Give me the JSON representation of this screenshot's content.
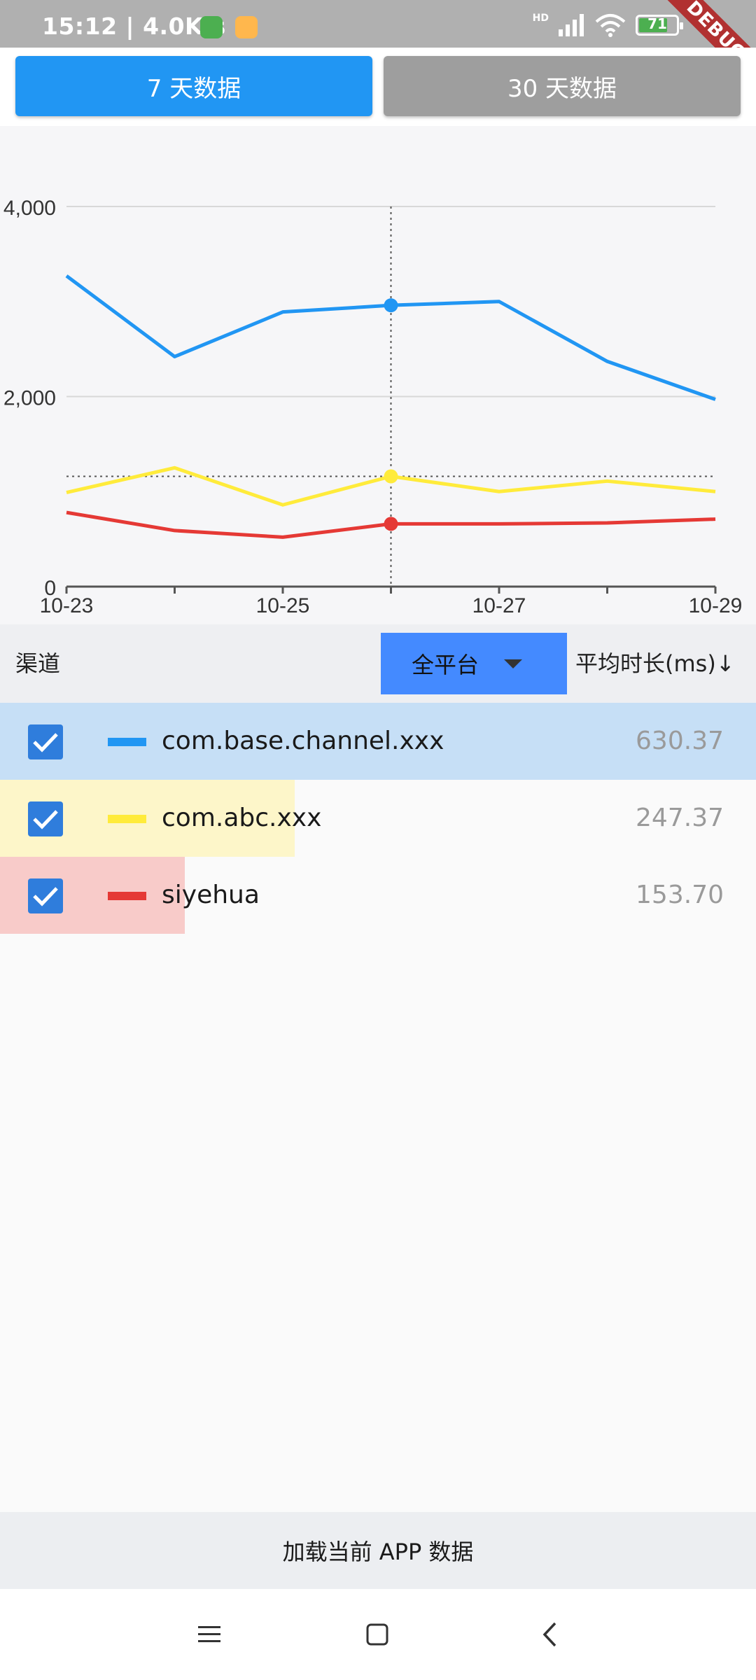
{
  "status_bar": {
    "time_speed": "15:12 | 4.0K/s",
    "battery_level": "71",
    "debug_label": "DEBUG",
    "network_label": "HD"
  },
  "tabs": [
    {
      "label": "7 天数据",
      "selected": true
    },
    {
      "label": "30 天数据",
      "selected": false
    }
  ],
  "chart_data": {
    "type": "line",
    "x": [
      "10-23",
      "10-24",
      "10-25",
      "10-26",
      "10-27",
      "10-28",
      "10-29"
    ],
    "x_tick_labels": [
      "10-23",
      "10-25",
      "10-27",
      "10-29"
    ],
    "y_tick_labels": [
      "0",
      "2,000",
      "4,000"
    ],
    "ylim": [
      0,
      4000
    ],
    "grid": true,
    "series": [
      {
        "color": "#2196f3",
        "values": [
          3270,
          2420,
          2890,
          2960,
          3000,
          2370,
          1970
        ]
      },
      {
        "color": "#ffeb3b",
        "values": [
          990,
          1250,
          860,
          1160,
          1000,
          1110,
          1000
        ]
      },
      {
        "color": "#e53935",
        "values": [
          780,
          590,
          520,
          660,
          660,
          670,
          710
        ]
      }
    ],
    "crosshair": {
      "x": "10-26",
      "y": 1160
    }
  },
  "table": {
    "channel_header": "渠道",
    "platform_selected": "全平台",
    "sort_header": "平均时长(ms)↓",
    "rows": [
      {
        "name": "com.base.channel.xxx",
        "value": "630.37",
        "checked": true,
        "color": "#2196f3",
        "bar_color": "#c6dff6",
        "share": 1.0
      },
      {
        "name": "com.abc.xxx",
        "value": "247.37",
        "checked": true,
        "color": "#ffeb3b",
        "bar_color": "#fdf6c9",
        "share": 0.39
      },
      {
        "name": "siyehua",
        "value": "153.70",
        "checked": true,
        "color": "#e53935",
        "bar_color": "#f8cbc9",
        "share": 0.244
      }
    ]
  },
  "load_button": {
    "label": "加载当前 APP 数据"
  }
}
